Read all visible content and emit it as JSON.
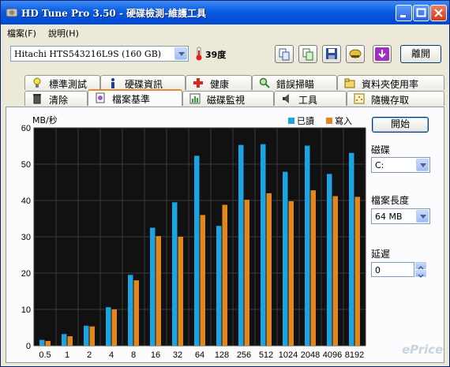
{
  "window": {
    "title": "HD Tune Pro 3.50 - 硬碟檢測-維護工具"
  },
  "menu": [
    {
      "label": "檔案(F)"
    },
    {
      "label": "說明(H)"
    }
  ],
  "toolbar": {
    "drive": "Hitachi HTS543216L9S (160 GB)",
    "temperature": "39度",
    "exit_label": "離開",
    "icons": [
      "copy-icon",
      "copy-all-icon",
      "save-icon",
      "settings-icon",
      "download-icon"
    ]
  },
  "tabs_row1": [
    {
      "label": "標準測試",
      "icon": "lightbulb-icon"
    },
    {
      "label": "硬碟資訊",
      "icon": "info-icon"
    },
    {
      "label": "健康",
      "icon": "health-cross-icon"
    },
    {
      "label": "錯誤掃瞄",
      "icon": "magnifier-icon"
    },
    {
      "label": "資料夾使用率",
      "icon": "folder-icon"
    }
  ],
  "tabs_row2": [
    {
      "label": "清除",
      "icon": "trash-icon"
    },
    {
      "label": "檔案基準",
      "icon": "file-bench-icon",
      "active": true
    },
    {
      "label": "磁碟監視",
      "icon": "monitor-chart-icon"
    },
    {
      "label": "工具",
      "icon": "speaker-icon"
    },
    {
      "label": "隨機存取",
      "icon": "random-access-icon"
    }
  ],
  "side": {
    "start_label": "開始",
    "disk_label": "磁碟",
    "disk_value": "C:",
    "file_length_label": "檔案長度",
    "file_length_value": "64 MB",
    "delay_label": "延遲",
    "delay_value": "0"
  },
  "watermark": "ePrice",
  "colors": {
    "read": "#1ca3e0",
    "write": "#e2861e",
    "plot_bg": "#111111",
    "grid": "#3a3a3a"
  },
  "chart_data": {
    "type": "bar",
    "ylabel": "MB/秒",
    "ylim": [
      0,
      60
    ],
    "yticks": [
      0,
      10,
      20,
      30,
      40,
      50,
      60
    ],
    "grid": true,
    "legend_position": "top-right",
    "categories": [
      "0.5",
      "1",
      "2",
      "4",
      "8",
      "16",
      "32",
      "64",
      "128",
      "256",
      "512",
      "1024",
      "2048",
      "4096",
      "8192"
    ],
    "series": [
      {
        "name": "已讀",
        "values": [
          1.6,
          3.2,
          5.5,
          10.6,
          19.5,
          32.5,
          39.5,
          52.3,
          33.0,
          55.3,
          55.5,
          47.9,
          55.1,
          47.3,
          53.1
        ]
      },
      {
        "name": "寫入",
        "values": [
          1.3,
          2.6,
          5.3,
          10.0,
          18.0,
          30.2,
          30.0,
          36.0,
          38.8,
          40.2,
          42.0,
          39.8,
          42.8,
          41.2,
          41.0
        ]
      }
    ]
  }
}
